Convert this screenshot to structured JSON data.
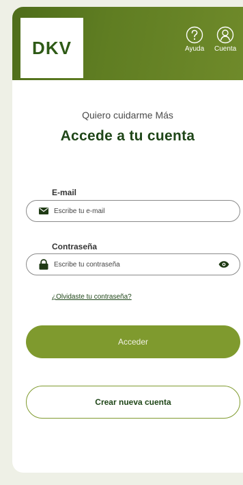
{
  "brand": {
    "logo_text": "DKV",
    "primary_color": "#5f7d22",
    "button_color": "#7f9a2e",
    "title_color": "#1f4618"
  },
  "header": {
    "help_label": "Ayuda",
    "help_icon": "question-circle-icon",
    "account_label": "Cuenta",
    "account_icon": "user-circle-icon"
  },
  "login": {
    "subtitle": "Quiero cuidarme Más",
    "title": "Accede a tu cuenta",
    "email": {
      "label": "E-mail",
      "placeholder": "Escribe tu e-mail",
      "icon": "envelope-icon",
      "value": ""
    },
    "password": {
      "label": "Contraseña",
      "placeholder": "Escribe tu contraseña",
      "icon": "lock-icon",
      "toggle_icon": "eye-icon",
      "value": ""
    },
    "forgot_link": "¿Olvidaste tu contraseña?",
    "submit_label": "Acceder",
    "create_account_label": "Crear nueva cuenta"
  }
}
